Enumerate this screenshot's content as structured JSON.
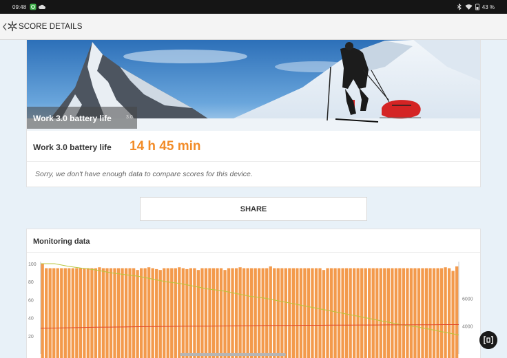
{
  "status": {
    "time": "09:48",
    "battery": "43 %"
  },
  "appbar": {
    "title": "SCORE DETAILS"
  },
  "hero": {
    "caption": "Work 3.0 battery life",
    "version": "3.0"
  },
  "score": {
    "label": "Work 3.0 battery life",
    "value": "14 h 45 min"
  },
  "compare_message": "Sorry, we don't have enough data to compare scores for this device.",
  "share_label": "SHARE",
  "monitoring": {
    "title": "Monitoring data"
  },
  "chart_data": {
    "type": "bar",
    "left_axis": {
      "ticks": [
        "20",
        "40",
        "60",
        "80",
        "100"
      ],
      "ylim": [
        0,
        100
      ]
    },
    "right_axis": {
      "ticks": [
        "4000",
        "6000"
      ],
      "ylim": [
        2000,
        8500
      ]
    },
    "series": [
      {
        "type": "bar",
        "color": "#f39a4c",
        "values": [
          100,
          95,
          95,
          95,
          95,
          95,
          95,
          95,
          95,
          95,
          95,
          95,
          95,
          95,
          95,
          96,
          95,
          95,
          95,
          95,
          95,
          95,
          95,
          95,
          95,
          93,
          95,
          95,
          96,
          95,
          94,
          93,
          95,
          95,
          95,
          95,
          96,
          95,
          94,
          95,
          95,
          93,
          95,
          95,
          95,
          95,
          95,
          95,
          93,
          95,
          95,
          95,
          96,
          95,
          95,
          95,
          95,
          95,
          95,
          95,
          97,
          95,
          95,
          95,
          95,
          95,
          95,
          95,
          95,
          95,
          95,
          95,
          95,
          95,
          93,
          95,
          95,
          95,
          95,
          95,
          95,
          95,
          95,
          95,
          95,
          95,
          95,
          95,
          95,
          95,
          95,
          95,
          95,
          95,
          95,
          95,
          95,
          95,
          95,
          95,
          95,
          95,
          95,
          95,
          95,
          95,
          96,
          95,
          92,
          97
        ]
      },
      {
        "type": "line",
        "axis": "left",
        "color": "#b8c63c",
        "values": [
          100,
          100,
          97,
          95,
          93,
          90,
          88,
          86,
          83,
          80,
          78,
          75,
          72,
          70,
          67,
          64,
          62,
          59,
          56,
          53,
          50,
          47,
          44,
          41,
          38,
          35,
          32,
          30,
          27,
          24,
          21
        ]
      },
      {
        "type": "line",
        "axis": "right",
        "color": "#e0482a",
        "values": [
          3850,
          3860,
          3880,
          3900,
          3920,
          3930,
          3940,
          3960,
          3970,
          3980,
          3990,
          4000,
          4000,
          4010,
          4020,
          4030,
          4040,
          4050,
          4050,
          4060,
          4060,
          4070,
          4070,
          4080,
          4080,
          4090,
          4090,
          4100,
          4100,
          4110,
          4110
        ]
      }
    ]
  }
}
